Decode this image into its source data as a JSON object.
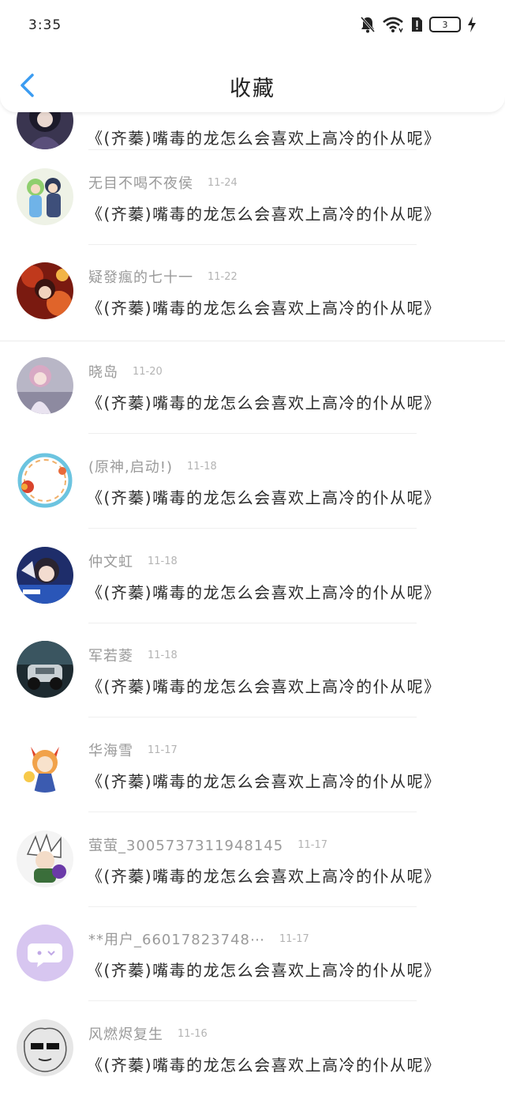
{
  "status_bar": {
    "time": "3:35",
    "battery": "3"
  },
  "nav": {
    "title": "收藏"
  },
  "colors": {
    "accent": "#3b9cf1"
  },
  "items": [
    {
      "name": "",
      "date": "",
      "title": "《(齐蓁)嘴毒的龙怎么会喜欢上高冷的仆从呢》",
      "avatar": "dark-anime-avatar"
    },
    {
      "name": "无目不喝不夜侯",
      "date": "11-24",
      "title": "《(齐蓁)嘴毒的龙怎么会喜欢上高冷的仆从呢》",
      "avatar": "green-anime-avatar"
    },
    {
      "name": "疑發瘋的七十一",
      "date": "11-22",
      "title": "《(齐蓁)嘴毒的龙怎么会喜欢上高冷的仆从呢》",
      "avatar": "red-anime-avatar"
    },
    {
      "name": "晓岛",
      "date": "11-20",
      "title": "《(齐蓁)嘴毒的龙怎么会喜欢上高冷的仆从呢》",
      "avatar": "pink-hair-avatar"
    },
    {
      "name": "(原神,启动!)",
      "date": "11-18",
      "title": "《(齐蓁)嘴毒的龙怎么会喜欢上高冷的仆从呢》",
      "avatar": "ring-frame-avatar"
    },
    {
      "name": "仲文虹",
      "date": "11-18",
      "title": "《(齐蓁)嘴毒的龙怎么会喜欢上高冷的仆从呢》",
      "avatar": "girl-photo-avatar"
    },
    {
      "name": "军若菱",
      "date": "11-18",
      "title": "《(齐蓁)嘴毒的龙怎么会喜欢上高冷的仆从呢》",
      "avatar": "car-avatar"
    },
    {
      "name": "华海雪",
      "date": "11-17",
      "title": "《(齐蓁)嘴毒的龙怎么会喜欢上高冷的仆从呢》",
      "avatar": "fox-girl-avatar"
    },
    {
      "name": "萤萤_3005737311948145",
      "date": "11-17",
      "title": "《(齐蓁)嘴毒的龙怎么会喜欢上高冷的仆从呢》",
      "avatar": "chibi-avatar"
    },
    {
      "name": "**用户_66017823748⋯",
      "date": "11-17",
      "title": "《(齐蓁)嘴毒的龙怎么会喜欢上高冷的仆从呢》",
      "avatar": "default-chat-avatar"
    },
    {
      "name": "风燃烬复生",
      "date": "11-16",
      "title": "《(齐蓁)嘴毒的龙怎么会喜欢上高冷的仆从呢》",
      "avatar": "sketch-avatar"
    }
  ]
}
